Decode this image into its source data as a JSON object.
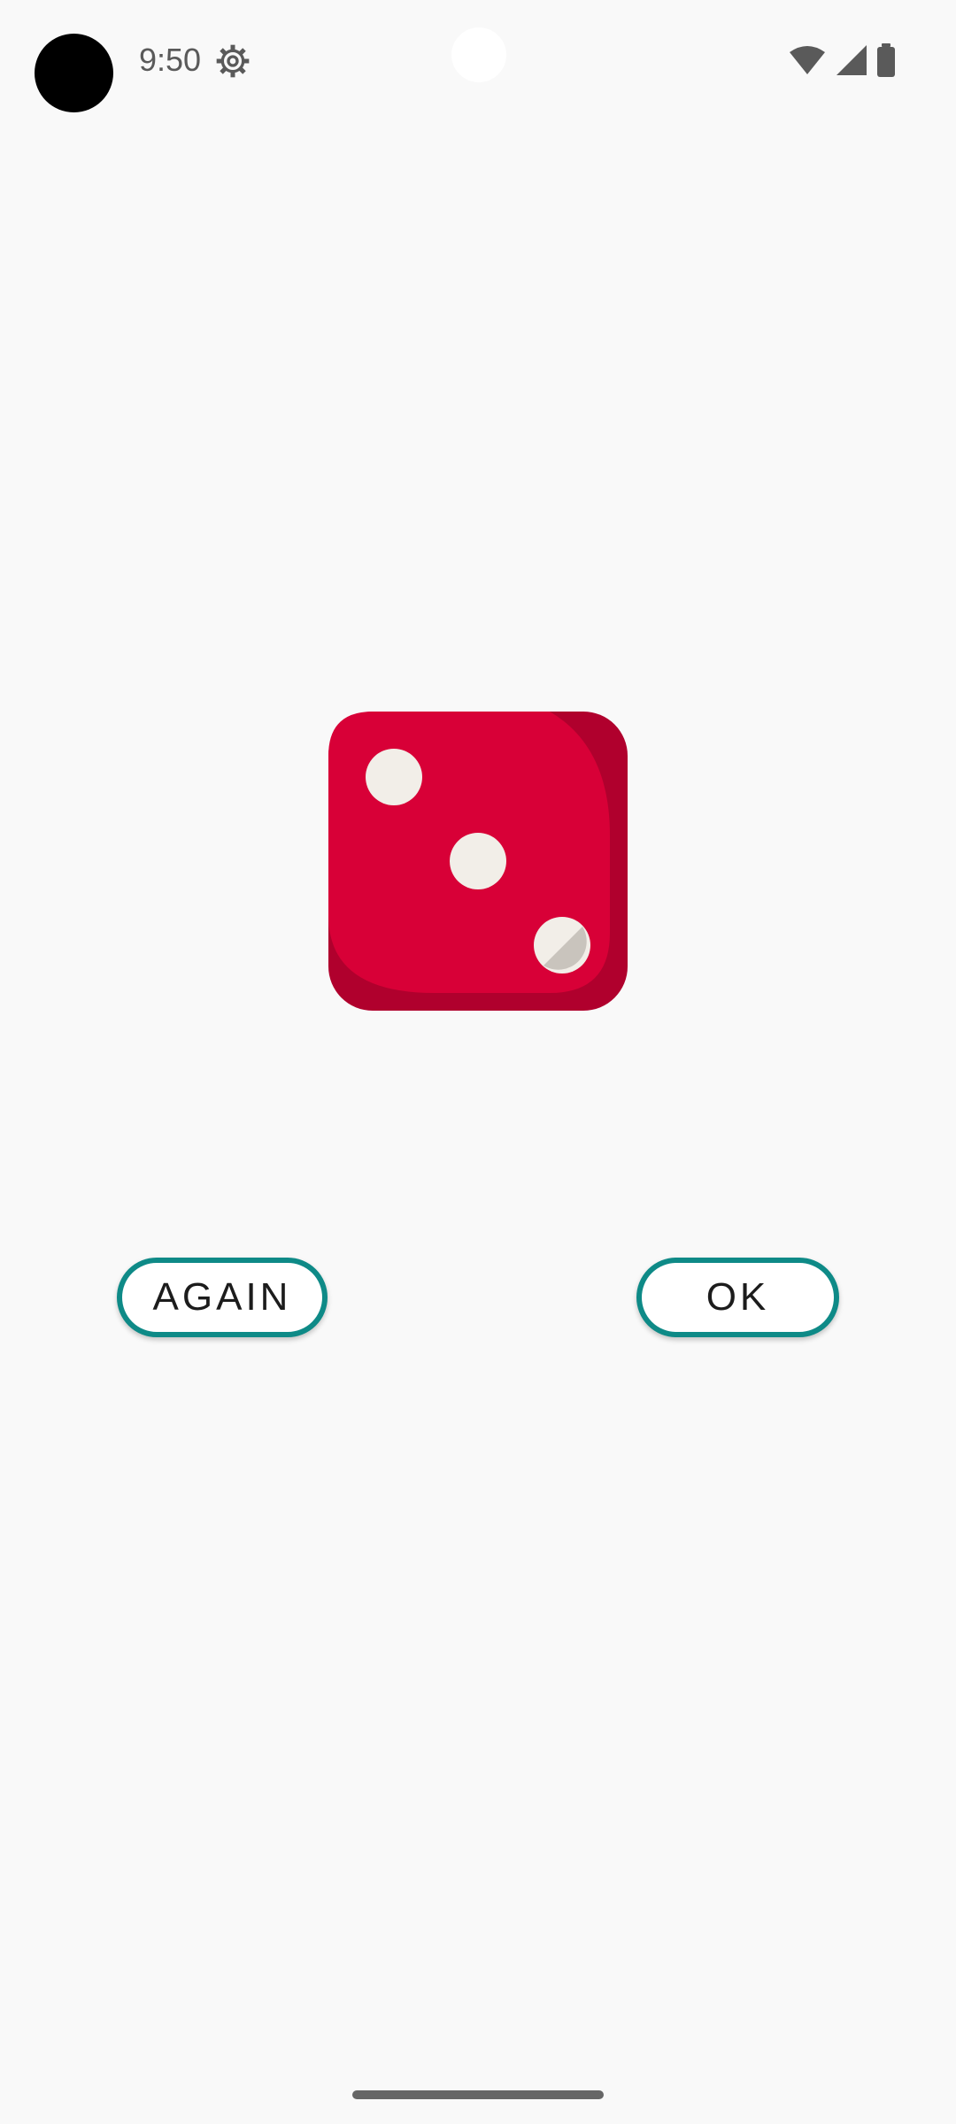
{
  "status_bar": {
    "time": "9:50",
    "icons": [
      "settings-gear-icon",
      "wifi-icon",
      "cellular-signal-icon",
      "battery-icon"
    ]
  },
  "dice": {
    "face_value": 3,
    "body_color": "#d80037",
    "shade_color": "#b0002d",
    "pip_color": "#f2eee8"
  },
  "buttons": {
    "again_label": "AGAIN",
    "ok_label": "OK",
    "border_color": "#0e8a87"
  }
}
